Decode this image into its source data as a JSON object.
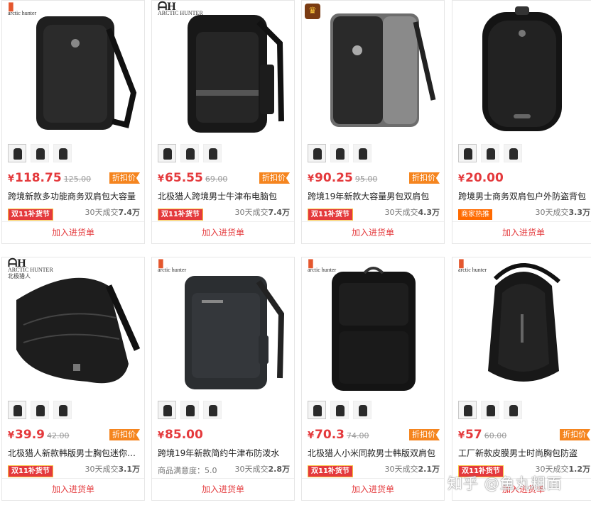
{
  "products": [
    {
      "brand": "arctic hunter",
      "price": "118.75",
      "old_price": "125.00",
      "discount": "折扣价",
      "title": "跨境新款多功能商务双肩包大容量",
      "badge": "双11补货节",
      "badge_type": "red",
      "sold_prefix": "30天成交",
      "sold_value": "7.4万",
      "cart": "加入进货单",
      "thumb_count": 3
    },
    {
      "brand": "ARCTIC HUNTER",
      "price": "65.55",
      "old_price": "69.00",
      "discount": "折扣价",
      "title": "北极猎人跨境男士牛津布电脑包",
      "badge": "双11补货节",
      "badge_type": "red",
      "sold_prefix": "30天成交",
      "sold_value": "7.4万",
      "cart": "加入进货单",
      "thumb_count": 3
    },
    {
      "brand": "",
      "price": "90.25",
      "old_price": "95.00",
      "discount": "折扣价",
      "title": "跨境19年新款大容量男包双肩包",
      "badge": "双11补货节",
      "badge_type": "red",
      "sold_prefix": "30天成交",
      "sold_value": "4.3万",
      "cart": "加入进货单",
      "thumb_count": 3
    },
    {
      "brand": "",
      "price": "20.00",
      "old_price": "",
      "discount": "",
      "title": "跨境男士商务双肩包户外防盗背包",
      "badge": "商家热推",
      "badge_type": "orange",
      "sold_prefix": "30天成交",
      "sold_value": "3.3万",
      "cart": "加入进货单",
      "thumb_count": 3
    },
    {
      "brand": "ARCTIC HUNTER",
      "brand_sub": "北极猎人",
      "price": "39.9",
      "old_price": "42.00",
      "discount": "折扣价",
      "title": "北极猎人新款韩版男士胸包迷你斜挎",
      "badge": "双11补货节",
      "badge_type": "red",
      "sold_prefix": "30天成交",
      "sold_value": "3.1万",
      "cart": "加入进货单",
      "thumb_count": 3
    },
    {
      "brand": "arctic hunter",
      "price": "85.00",
      "old_price": "",
      "discount": "",
      "title": "跨境19年新款简约牛津布防泼水",
      "badge": "",
      "badge_type": "none",
      "satisfaction": "商品满意度：5.0",
      "sold_prefix": "30天成交",
      "sold_value": "2.8万",
      "cart": "加入进货单",
      "thumb_count": 3
    },
    {
      "brand": "arctic hunter",
      "price": "70.3",
      "old_price": "74.00",
      "discount": "折扣价",
      "title": "北极猎人小米同款男士韩版双肩包",
      "badge": "双11补货节",
      "badge_type": "red",
      "sold_prefix": "30天成交",
      "sold_value": "2.1万",
      "cart": "加入进货单",
      "thumb_count": 3
    },
    {
      "brand": "arctic hunter",
      "price": "57",
      "old_price": "60.00",
      "discount": "折扣价",
      "title": "工厂新款皮膜男士时尚胸包防盗",
      "badge": "双11补货节",
      "badge_type": "red",
      "sold_prefix": "30天成交",
      "sold_value": "1.2万",
      "cart": "加入进货单",
      "thumb_count": 3
    }
  ],
  "currency": "¥",
  "watermark": "知乎 @鱼丸粗面"
}
